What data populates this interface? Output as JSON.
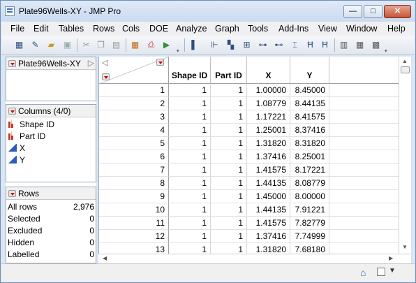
{
  "window": {
    "title": "Plate96Wells-XY - JMP Pro",
    "min_glyph": "—",
    "max_glyph": "□",
    "close_glyph": "✕"
  },
  "menu": [
    "File",
    "Edit",
    "Tables",
    "Rows",
    "Cols",
    "DOE",
    "Analyze",
    "Graph",
    "Tools",
    "Add-Ins",
    "View",
    "Window",
    "Help"
  ],
  "table_panel": {
    "name": "Plate96Wells-XY"
  },
  "columns_panel": {
    "title": "Columns (4/0)",
    "items": [
      {
        "name": "Shape ID",
        "type": "nominal"
      },
      {
        "name": "Part ID",
        "type": "nominal"
      },
      {
        "name": "X",
        "type": "continuous"
      },
      {
        "name": "Y",
        "type": "continuous"
      }
    ]
  },
  "rows_panel": {
    "title": "Rows",
    "stats": [
      {
        "label": "All rows",
        "value": "2,976"
      },
      {
        "label": "Selected",
        "value": "0"
      },
      {
        "label": "Excluded",
        "value": "0"
      },
      {
        "label": "Hidden",
        "value": "0"
      },
      {
        "label": "Labelled",
        "value": "0"
      }
    ]
  },
  "grid": {
    "headers": [
      "Shape ID",
      "Part ID",
      "X",
      "Y"
    ],
    "rows": [
      [
        "1",
        "1",
        "1",
        "1.00000",
        "8.45000"
      ],
      [
        "2",
        "1",
        "1",
        "1.08779",
        "8.44135"
      ],
      [
        "3",
        "1",
        "1",
        "1.17221",
        "8.41575"
      ],
      [
        "4",
        "1",
        "1",
        "1.25001",
        "8.37416"
      ],
      [
        "5",
        "1",
        "1",
        "1.31820",
        "8.31820"
      ],
      [
        "6",
        "1",
        "1",
        "1.37416",
        "8.25001"
      ],
      [
        "7",
        "1",
        "1",
        "1.41575",
        "8.17221"
      ],
      [
        "8",
        "1",
        "1",
        "1.44135",
        "8.08779"
      ],
      [
        "9",
        "1",
        "1",
        "1.45000",
        "8.00000"
      ],
      [
        "10",
        "1",
        "1",
        "1.44135",
        "7.91221"
      ],
      [
        "11",
        "1",
        "1",
        "1.41575",
        "7.82779"
      ],
      [
        "12",
        "1",
        "1",
        "1.37416",
        "7.74999"
      ],
      [
        "13",
        "1",
        "1",
        "1.31820",
        "7.68180"
      ]
    ]
  }
}
